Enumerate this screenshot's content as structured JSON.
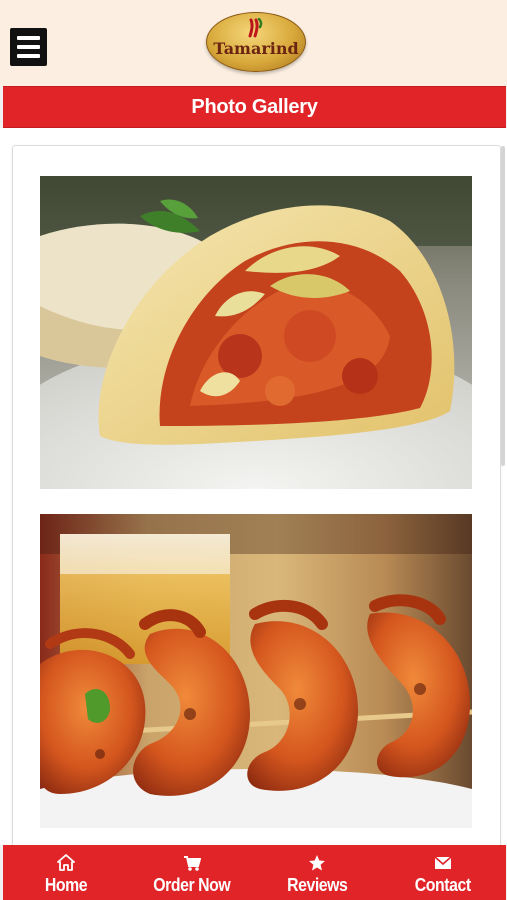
{
  "header": {
    "logo_text": "Tamarind",
    "brand_colors": {
      "header_bg": "#fcefe1",
      "accent_red": "#e02428",
      "logo_gold": "#d8a93b"
    },
    "menu_icon": "hamburger-menu-icon"
  },
  "page": {
    "title": "Photo Gallery"
  },
  "gallery": {
    "photos": [
      {
        "alt": "",
        "icon": "wrap-photo"
      },
      {
        "alt": "",
        "icon": "shrimp-photo"
      }
    ]
  },
  "nav": {
    "items": [
      {
        "label": "Home",
        "icon": "home-icon"
      },
      {
        "label": "Order Now",
        "icon": "cart-icon"
      },
      {
        "label": "Reviews",
        "icon": "star-icon"
      },
      {
        "label": "Contact",
        "icon": "mail-icon"
      }
    ]
  }
}
